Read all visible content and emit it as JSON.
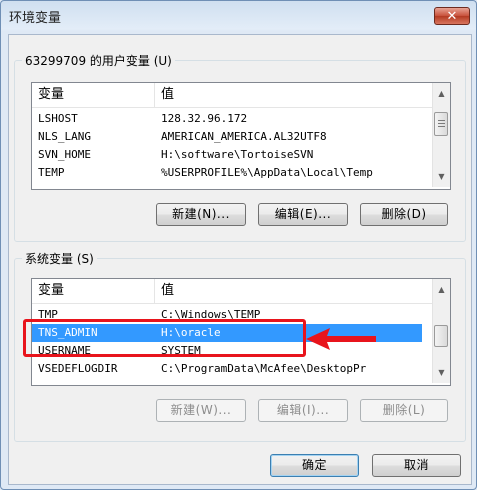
{
  "window": {
    "title": "环境变量",
    "close_glyph": "✕"
  },
  "user_vars": {
    "group_label": "63299709 的用户变量 (U)",
    "columns": [
      "变量",
      "值"
    ],
    "rows": [
      {
        "name": "LSHOST",
        "value": "128.32.96.172"
      },
      {
        "name": "NLS_LANG",
        "value": "AMERICAN_AMERICA.AL32UTF8"
      },
      {
        "name": "SVN_HOME",
        "value": "H:\\software\\TortoiseSVN"
      },
      {
        "name": "TEMP",
        "value": "%USERPROFILE%\\AppData\\Local\\Temp"
      }
    ],
    "buttons": {
      "new": "新建(N)...",
      "edit": "编辑(E)...",
      "delete": "删除(D)"
    }
  },
  "system_vars": {
    "group_label": "系统变量 (S)",
    "columns": [
      "变量",
      "值"
    ],
    "rows": [
      {
        "name": "TMP",
        "value": "C:\\Windows\\TEMP"
      },
      {
        "name": "TNS_ADMIN",
        "value": "H:\\oracle",
        "selected": true
      },
      {
        "name": "USERNAME",
        "value": "SYSTEM"
      },
      {
        "name": "VSEDEFLOGDIR",
        "value": "C:\\ProgramData\\McAfee\\DesktopPr"
      }
    ],
    "buttons": {
      "new": "新建(W)...",
      "edit": "编辑(I)...",
      "delete": "删除(L)"
    }
  },
  "footer": {
    "ok": "确定",
    "cancel": "取消"
  },
  "colors": {
    "selection": "#3399ff",
    "annotation": "#e8141c"
  },
  "icons": {
    "scroll_up": "scroll-up-icon",
    "scroll_down": "scroll-down-icon",
    "annotation": "red-arrow-icon"
  }
}
